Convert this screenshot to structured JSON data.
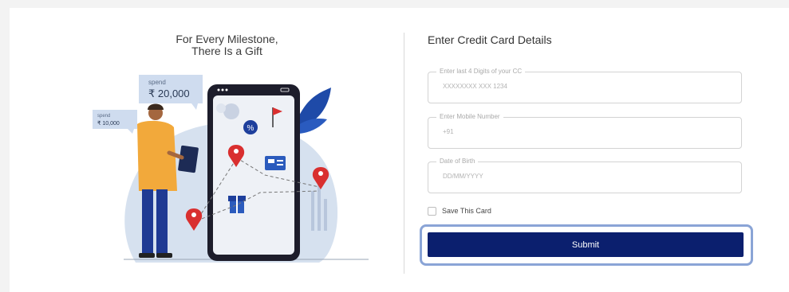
{
  "promo": {
    "headline_line1": "For Every Milestone,",
    "headline_line2": "There Is a Gift",
    "bubble_large": {
      "caption": "spend",
      "amount": "₹ 20,000"
    },
    "bubble_small": {
      "caption": "spend",
      "amount": "₹ 10,000"
    }
  },
  "form": {
    "title": "Enter Credit Card Details",
    "card_field": {
      "label": "Enter last 4 Digits of your CC",
      "placeholder": "XXXXXXXX XXX 1234",
      "value": ""
    },
    "mobile_field": {
      "label": "Enter Mobile Number",
      "placeholder": "+91",
      "value": ""
    },
    "dob_field": {
      "label": "Date of Birth",
      "placeholder": "DD/MM/YYYY",
      "value": ""
    },
    "save_card": {
      "label": "Save This Card",
      "checked": false
    },
    "submit_label": "Submit"
  },
  "colors": {
    "primary": "#0b1f6e",
    "highlight": "#8aa4d6",
    "pin": "#d92f2f",
    "person_shirt": "#f2a93b",
    "illustration_blob": "#d6e1ef"
  },
  "icons": [
    "location-pin-icon",
    "percent-icon",
    "gift-icon",
    "ticket-icon",
    "flag-icon"
  ]
}
